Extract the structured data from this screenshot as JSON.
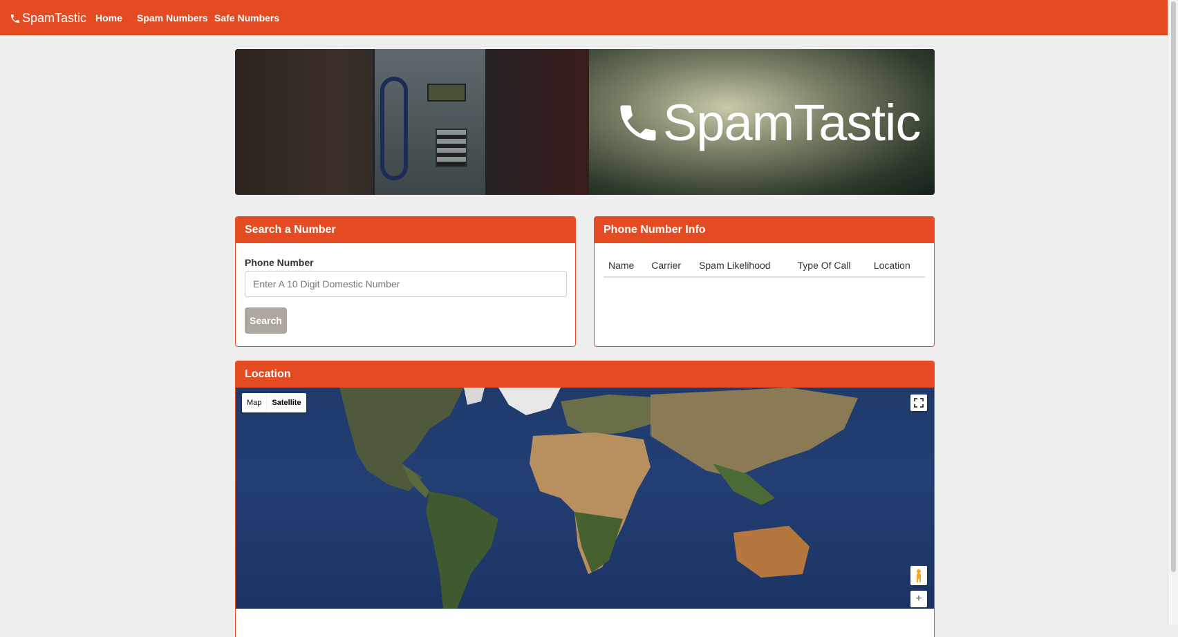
{
  "navbar": {
    "brand": "SpamTastic",
    "links": [
      "Home",
      "Spam Numbers",
      "Safe Numbers"
    ]
  },
  "banner": {
    "title": "SpamTastic"
  },
  "search_panel": {
    "heading": "Search a Number",
    "field_label": "Phone Number",
    "placeholder": "Enter A 10 Digit Domestic Number",
    "button": "Search"
  },
  "info_panel": {
    "heading": "Phone Number Info",
    "columns": [
      "Name",
      "Carrier",
      "Spam Likelihood",
      "Type Of Call",
      "Location"
    ]
  },
  "location_panel": {
    "heading": "Location",
    "map_types": [
      "Map",
      "Satellite"
    ],
    "selected_map_type": "Satellite",
    "zoom_in_label": "+"
  },
  "colors": {
    "accent": "#e44b22",
    "button": "#aea79f"
  },
  "icons": [
    "phone-icon",
    "fullscreen-icon",
    "pegman-icon",
    "zoom-in-icon"
  ]
}
